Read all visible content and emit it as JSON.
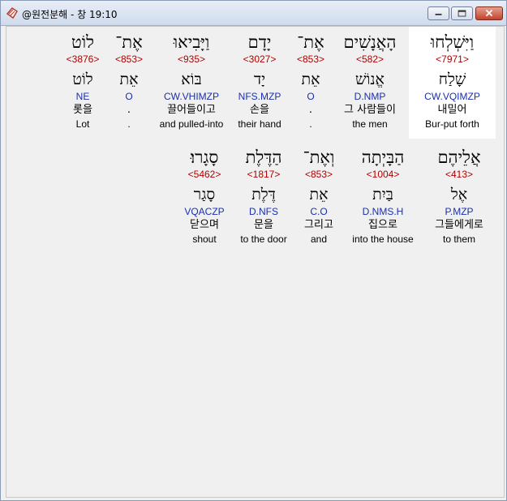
{
  "window": {
    "title": "@원전분해 - 창 19:10"
  },
  "colors": {
    "strong": "#b00000",
    "parse": "#1a2fb0",
    "selected_bg": "#ffffff"
  },
  "rows": [
    {
      "words": [
        {
          "hebrew": "וַיִּשְׁלְחוּ",
          "strong": "<7971>",
          "lemma": "שָׁלַח",
          "parse": "CW.VQIMZP",
          "korean": "내밀어",
          "english": "Bur-put forth",
          "selected": true
        },
        {
          "hebrew": "הָאֲנָשִׁים",
          "strong": "<582>",
          "lemma": "אֱנוֹשׁ",
          "parse": "D.NMP",
          "korean": "그 사람들이",
          "english": "the men",
          "selected": false
        },
        {
          "hebrew": "אֶת־",
          "strong": "<853>",
          "lemma": "אֵת",
          "parse": "O",
          "korean": ".",
          "english": ".",
          "selected": false
        },
        {
          "hebrew": "יָדָם",
          "strong": "<3027>",
          "lemma": "יָד",
          "parse": "NFS.MZP",
          "korean": "손을",
          "english": "their hand",
          "selected": false
        },
        {
          "hebrew": "וַיָּבִיאוּ",
          "strong": "<935>",
          "lemma": "בּוֹא",
          "parse": "CW.VHIMZP",
          "korean": "끌어들이고",
          "english": "and pulled-into",
          "selected": false
        },
        {
          "hebrew": "אֶת־",
          "strong": "<853>",
          "lemma": "אֵת",
          "parse": "O",
          "korean": ".",
          "english": ".",
          "selected": false
        },
        {
          "hebrew": "לוֹט",
          "strong": "<3876>",
          "lemma": "לוֹט",
          "parse": "NE",
          "korean": "롯을",
          "english": "Lot",
          "selected": false
        }
      ]
    },
    {
      "words": [
        {
          "hebrew": "אֲלֵיהֶם",
          "strong": "<413>",
          "lemma": "אֶל",
          "parse": "P.MZP",
          "korean": "그들에게로",
          "english": "to them",
          "selected": false
        },
        {
          "hebrew": "הַבָּיְתָה",
          "strong": "<1004>",
          "lemma": "בַּיִת",
          "parse": "D.NMS.H",
          "korean": "집으로",
          "english": "into the house",
          "selected": false
        },
        {
          "hebrew": "וְאֶת־",
          "strong": "<853>",
          "lemma": "אֵת",
          "parse": "C.O",
          "korean": "그리고",
          "english": "and",
          "selected": false
        },
        {
          "hebrew": "הַדֶּלֶת",
          "strong": "<1817>",
          "lemma": "דֶּלֶת",
          "parse": "D.NFS",
          "korean": "문을",
          "english": "to the door",
          "selected": false
        },
        {
          "hebrew": "סָגָרוּ׃",
          "strong": "<5462>",
          "lemma": "סָגַר",
          "parse": "VQACZP",
          "korean": "닫으며",
          "english": "shout",
          "selected": false
        }
      ]
    }
  ]
}
